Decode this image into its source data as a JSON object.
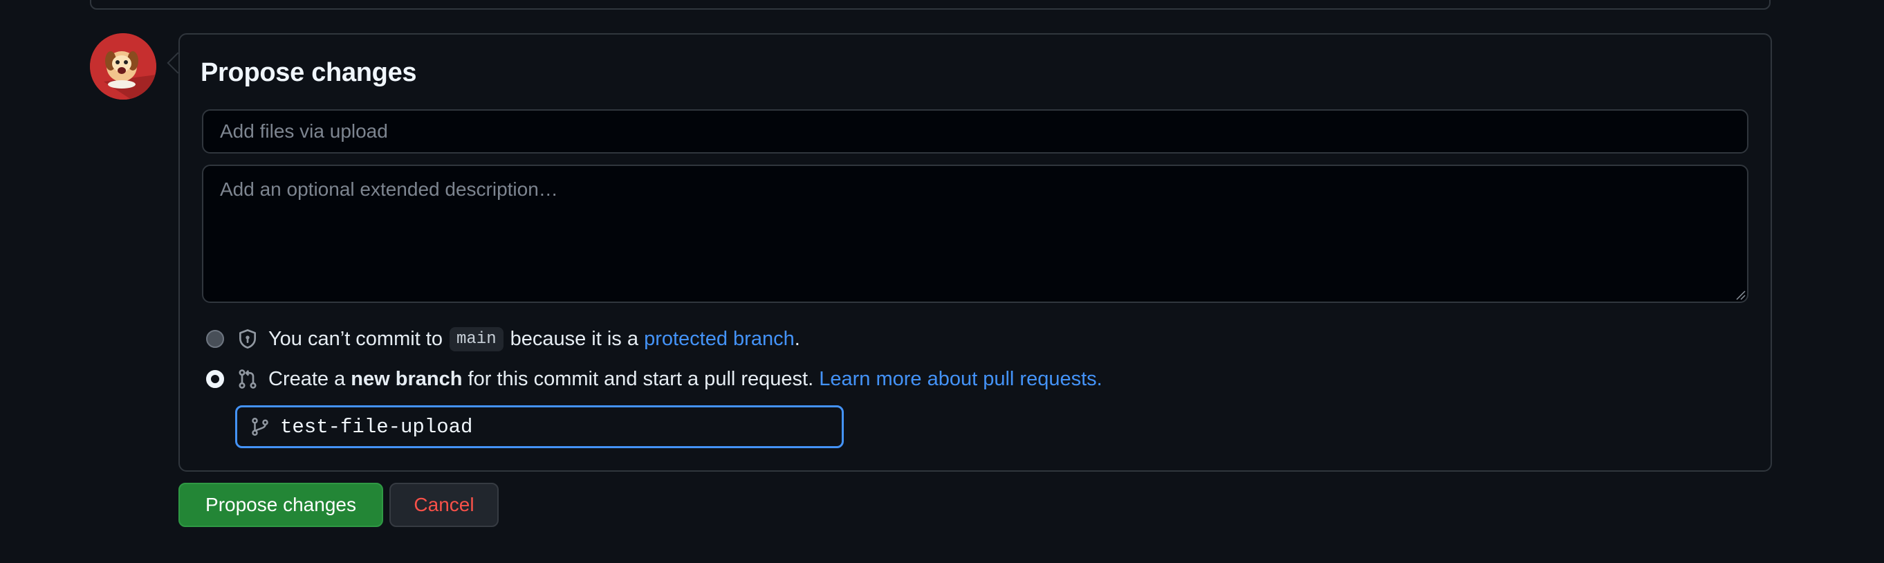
{
  "form": {
    "title": "Propose changes",
    "commit_summary_placeholder": "Add files via upload",
    "description_placeholder": "Add an optional extended description…"
  },
  "options": {
    "protected": {
      "text_before": "You can’t commit to",
      "branch_name": "main",
      "text_middle": "because it is a",
      "link_text": "protected branch",
      "text_after": "."
    },
    "new_branch": {
      "text_before": "Create a",
      "bold_text": "new branch",
      "text_middle": "for this commit and start a pull request.",
      "link_text": "Learn more about pull requests."
    }
  },
  "branch_input": {
    "value": "test-file-upload"
  },
  "buttons": {
    "propose": "Propose changes",
    "cancel": "Cancel"
  },
  "colors": {
    "background": "#0d1117",
    "primary_button": "#238636",
    "cancel_text": "#f85149",
    "link": "#4493f8",
    "focus_border": "#4493f8"
  }
}
